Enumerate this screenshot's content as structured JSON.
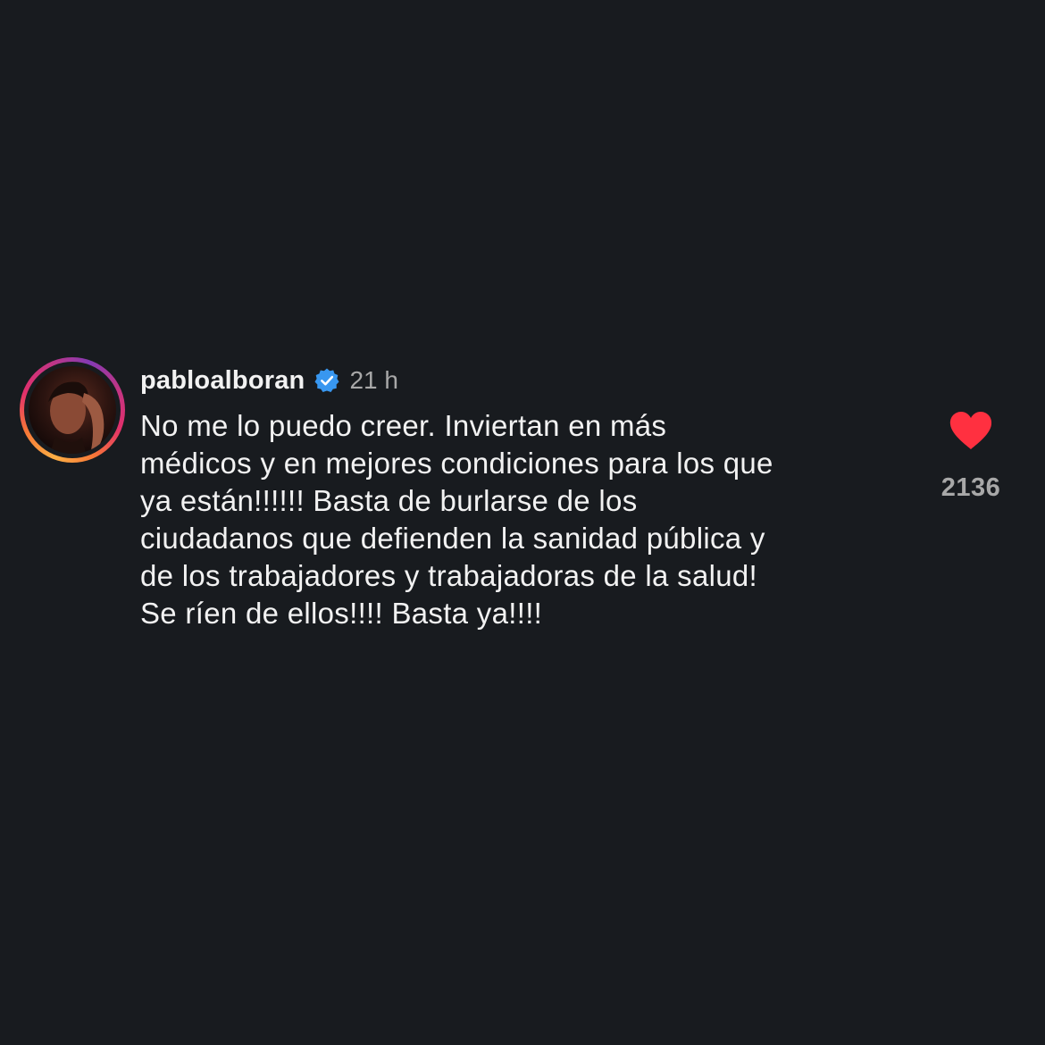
{
  "comment": {
    "username": "pabloalboran",
    "verified_icon": "verified-badge-icon",
    "timestamp": "21 h",
    "lines": [
      "No me lo puedo creer. Inviertan en más",
      "médicos y en mejores condiciones para los que",
      "ya están!!!!!! Basta de burlarse de los",
      "ciudadanos que defienden la sanidad pública y",
      "de los trabajadores y trabajadoras de la salud!",
      "Se ríen de ellos!!!! Basta ya!!!!"
    ],
    "like_icon": "heart-filled-icon",
    "like_count": "2136"
  },
  "colors": {
    "background": "#181b1f",
    "text": "#f2f2f2",
    "muted": "#a8a8a8",
    "heart": "#ff3040",
    "verified": "#3897f0"
  }
}
